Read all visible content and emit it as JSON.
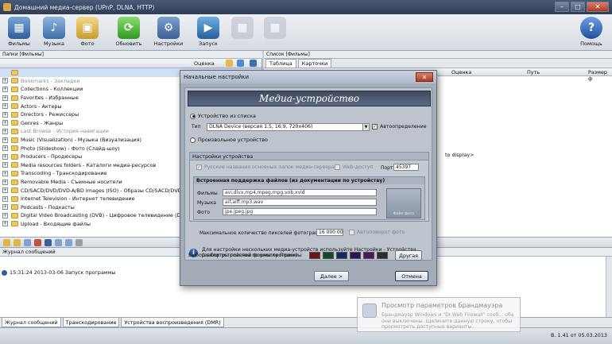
{
  "window": {
    "title": "Домашний медиа-сервер (UPnP, DLNA, HTTP)"
  },
  "toolbar": {
    "items": [
      {
        "label": "Фильмы"
      },
      {
        "label": "Музыка"
      },
      {
        "label": "Фото"
      },
      {
        "label": "Обновить"
      },
      {
        "label": "Настройки"
      },
      {
        "label": "Запуск"
      },
      {
        "label": "Помощь"
      }
    ]
  },
  "left_pane": {
    "header": "Папки [Фильмы]",
    "col_rating": "Оценка",
    "tree": [
      {
        "label": "Bookmarks - Закладки",
        "grey": true
      },
      {
        "label": "Collections - Коллекции"
      },
      {
        "label": "Favorites - Избранные"
      },
      {
        "label": "Actors - Актеры"
      },
      {
        "label": "Directors - Режиссеры"
      },
      {
        "label": "Genres - Жанры"
      },
      {
        "label": "Last Browse - История навигации",
        "grey": true
      },
      {
        "label": "Music (Visualization) - Музыка (Визуализация)"
      },
      {
        "label": "Photo (Slideshow) - Фото (Слайд-шоу)"
      },
      {
        "label": "Producers - Продюсеры"
      },
      {
        "label": "Media resources folders - Каталоги медиа-ресурсов"
      },
      {
        "label": "Transcoding - Транскодирование"
      },
      {
        "label": "Removable Media - Съемные носители"
      },
      {
        "label": "CD/SACD/DVD/DVD-A/BD Images (ISO) - Образы CD/SACD/DVD/DVD-A/B"
      },
      {
        "label": "Internet Television - Интернет телевидение"
      },
      {
        "label": "Podcasts - Подкасты"
      },
      {
        "label": "Digital Video Broadcasting (DVB) - Цифровое телевидение (DVB)"
      },
      {
        "label": "Upload - Входящие файлы"
      }
    ]
  },
  "right_pane": {
    "header": "Список [Фильмы]",
    "tabs": [
      "Таблица",
      "Карточки"
    ],
    "cols": [
      "Оценка",
      "Путь",
      "Размер ф"
    ],
    "fragment": "to display>"
  },
  "log": {
    "header": "Журнал сообщений",
    "line": "15:31:24 2013-03-06 Запуск программы"
  },
  "bottom_tabs": [
    "Журнал сообщений",
    "Транскодирование",
    "Устройства воспроизведения (DMR)"
  ],
  "status": {
    "version": "В. 1.41 от 05.03.2013"
  },
  "dialog": {
    "title": "Начальные настройки",
    "banner": "Медиа-устройство",
    "radio_list": "Устройство из списка",
    "type_label": "Тип",
    "type_value": "DLNA Device (версия 1.5, 16:9, 720x406)",
    "autodetect": "Автоопределение",
    "radio_custom": "Произвольное устройство",
    "settings_title": "Настройки устройства",
    "russian_names": "Русские названия основных папок медиа-сервера",
    "web_access": "Web-доступ",
    "port_label": "Порт",
    "port_value": "45397",
    "formats_title": "Встроенная поддержка файлов (из документации по устройству)",
    "formats": [
      {
        "label": "Фильмы",
        "value": "avi,divx,mp4,mpeg,mpg,vob,xvid"
      },
      {
        "label": "Музыка",
        "value": "aif,aiff,mp3,wav"
      },
      {
        "label": "Фото",
        "value": "jpe,jpeg,jpg"
      }
    ],
    "device_image": "Файл фото",
    "max_pixels_label": "Максимальное количество пикселей фотографий",
    "max_pixels_value": "16 000 000",
    "autorotate": "Автоповорот фото",
    "info": "Для настройки нескольких медиа-устройств используйте Настройки - Устройства (выбор устройства по кнопке Поиск)",
    "palette_label": "Выбор палитры главной формы программы",
    "palette_colors": [
      "#6b1414",
      "#0f4a2a",
      "#13285f",
      "#2a1458",
      "#4a1550",
      "#2d2d2d"
    ],
    "other_button": "Другая",
    "next_button": "Далее >",
    "cancel_button": "Отмена"
  },
  "toast": {
    "title": "Просмотр параметров брандмауэра",
    "body": "Брандмауэр Windows и \"Dr.Web Firewall\" сооб... оба они выключены. Щелкните данную строку, чтобы просмотреть доступные варианты."
  }
}
